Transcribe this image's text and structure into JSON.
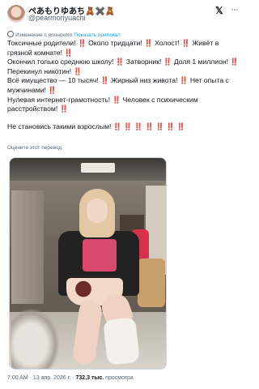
{
  "author": {
    "display_name": "ぺあもりゆあち🧸✖️🧸",
    "handle": "@pearmoriyuachi"
  },
  "header": {
    "x_logo_text": "𝕏",
    "more_icon_text": "···"
  },
  "translation": {
    "translated_label": "Изменение с японского",
    "show_original_label": "Показать оригинал",
    "rate_label": "Оцените этот перевод"
  },
  "tweet": {
    "lines": [
      "Токсичные родители! ‼️ Около тридцати! ‼️ Холост! ‼️ Живёт в грязной комнате! ‼️",
      "Окончил только среднюю школу! ‼️ Затворник! ‼️ Доля 1 миллион! ‼️ Перекинул никотин! ‼️",
      "Всё имущество — 10 тысяч! ‼️ Жирный низ живота! ‼️ Нет опыта с мужчинами! ‼️",
      "Нулевая интернет-грамотность! ‼️ Человек с психическим расстройством! ‼️"
    ],
    "closing_line": "Не становись такими взрослым! ‼️ ‼️ ‼️ ‼️ ‼️ ‼️ ‼️"
  },
  "media": {
    "alt": "photo"
  },
  "footer": {
    "time": "7:00 AM",
    "separator": " · ",
    "date": "13 апр. 2026 г.",
    "views_count": "732,3 тыс.",
    "views_label": " просмотра"
  },
  "colors": {
    "accent": "#1d9bf0",
    "emphasis": "#e0245e",
    "secondary_text": "#536471"
  }
}
